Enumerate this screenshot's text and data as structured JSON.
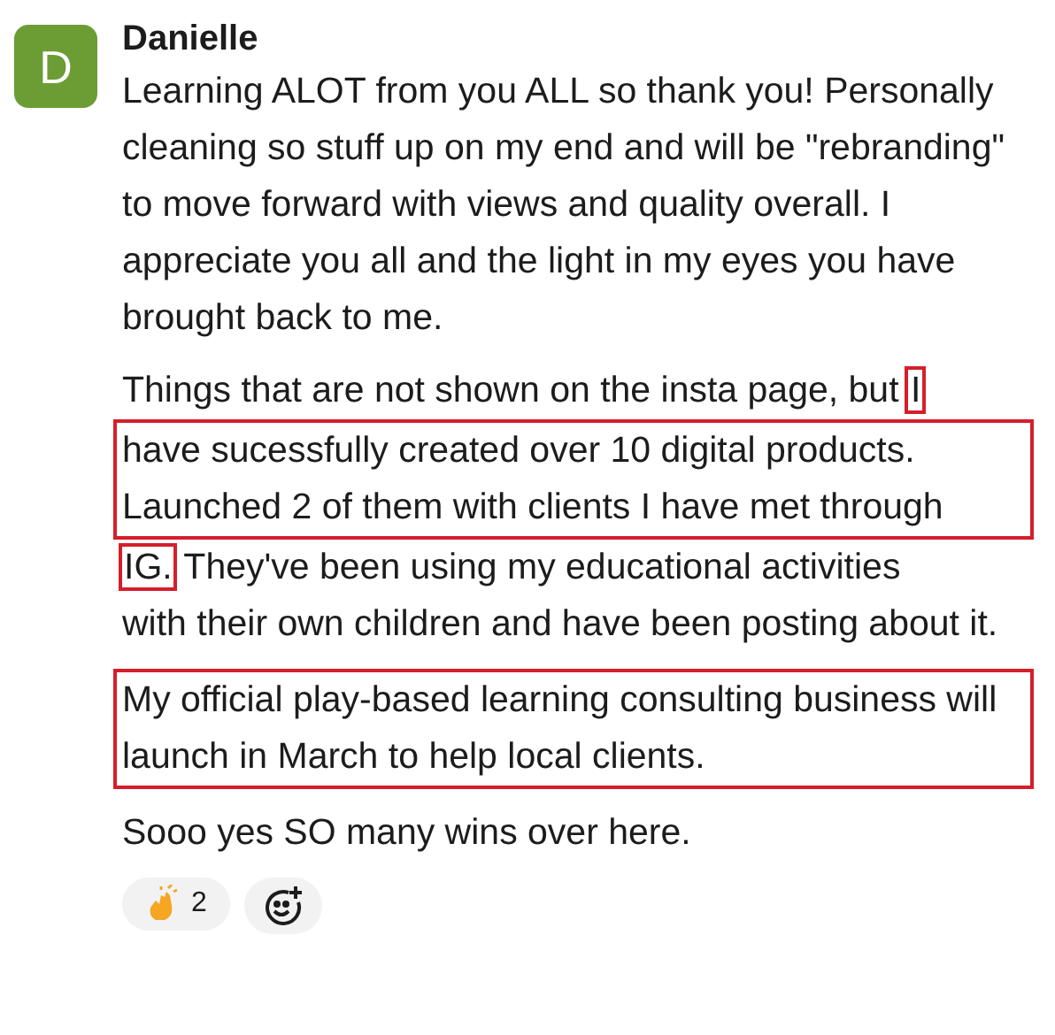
{
  "message": {
    "avatar_letter": "D",
    "author": "Danielle",
    "paragraphs": [
      {
        "segments": [
          {
            "text": "Learning ALOT from you ALL so thank you! Personally cleaning so stuff up on my end and will be \"rebranding\" to move forward with views and quality overall. I appreciate you all and the light in my eyes you have brought back to me.",
            "kind": "block"
          }
        ]
      },
      {
        "segments": [
          {
            "text": "Things that are not shown on the insta page, but",
            "kind": "inline"
          },
          {
            "text": "I",
            "kind": "boxed"
          },
          {
            "text": "have sucessfully created over 10 digital products. Launched 2 of them with clients I have met through",
            "kind": "boxed-block"
          },
          {
            "text": "IG.",
            "kind": "boxed"
          },
          {
            "text": "They've been using my educational activities",
            "kind": "inline"
          },
          {
            "text": "with their own children and have been posting about it.",
            "kind": "block"
          }
        ]
      },
      {
        "segments": [
          {
            "text": "My official play-based learning consulting business will launch in March to help local clients.",
            "kind": "boxed-block"
          }
        ]
      },
      {
        "segments": [
          {
            "text": "Sooo yes SO many wins over here.",
            "kind": "block"
          }
        ]
      }
    ],
    "reactions": [
      {
        "count": "2",
        "selected": false
      }
    ]
  }
}
